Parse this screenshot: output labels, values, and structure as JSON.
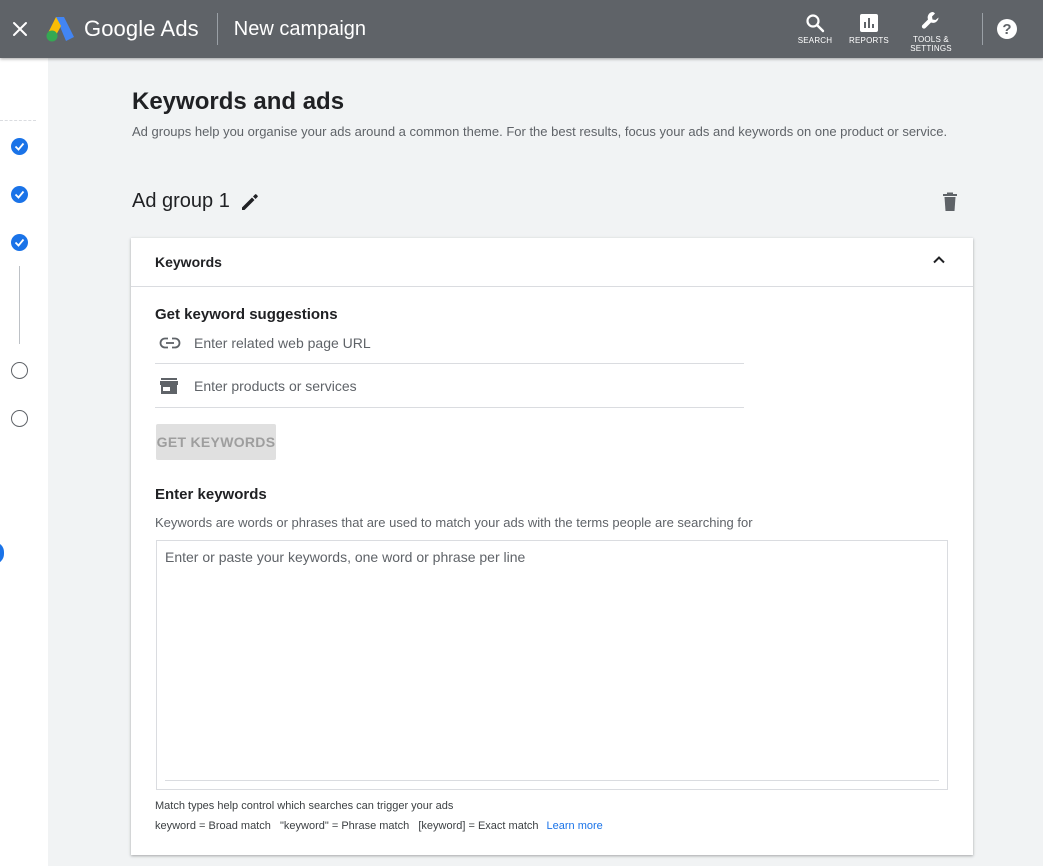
{
  "app": {
    "brand_name": "Google Ads",
    "title": "New campaign",
    "colors": {
      "topbar": "#5f6368",
      "accent": "#1a73e8"
    }
  },
  "top_actions": {
    "search_label": "SEARCH",
    "reports_label": "REPORTS",
    "tools_label_line1": "TOOLS &",
    "tools_label_line2": "SETTINGS",
    "help_label": "?"
  },
  "stepper": {
    "steps": [
      {
        "state": "completed",
        "icon": "check-icon"
      },
      {
        "state": "completed",
        "icon": "check-icon"
      },
      {
        "state": "completed",
        "icon": "check-icon"
      },
      {
        "state": "incomplete",
        "icon": "circle-icon"
      },
      {
        "state": "incomplete",
        "icon": "circle-icon"
      }
    ]
  },
  "page": {
    "title": "Keywords and ads",
    "description": "Ad groups help you organise your ads around a common theme. For the best results, focus your ads and keywords on one product or service."
  },
  "ad_group": {
    "name": "Ad group 1"
  },
  "keywords_card": {
    "header_title": "Keywords",
    "suggestions": {
      "title": "Get keyword suggestions",
      "url_placeholder": "Enter related web page URL",
      "products_placeholder": "Enter products or services",
      "get_button_label": "GET KEYWORDS"
    },
    "enter_keywords": {
      "title": "Enter keywords",
      "description": "Keywords are words or phrases that are used to match your ads with the terms people are searching for",
      "textarea_placeholder": "Enter or paste your keywords, one word or phrase per line"
    },
    "match_note": "Match types help control which searches can trigger your ads",
    "match_types_text": "keyword = Broad match   \"keyword\" = Phrase match   [keyword] = Exact match",
    "learn_more_label": "Learn more"
  }
}
